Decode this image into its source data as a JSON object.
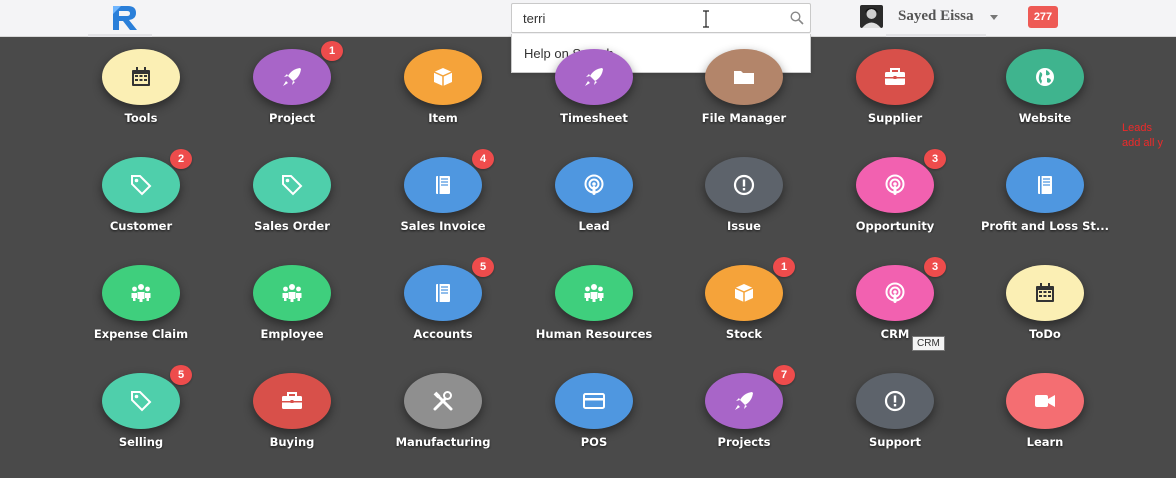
{
  "search": {
    "value": "terri",
    "dropdown_item": "Help on Search"
  },
  "user": {
    "name": "Sayed Eissa",
    "notifications": "277"
  },
  "tooltip": "CRM",
  "side_note": {
    "line1": "Leads",
    "line2": "add all y"
  },
  "tiles": [
    {
      "label": "Tools",
      "color": "#fbefb4",
      "icon": "calendar-icon",
      "badge": ""
    },
    {
      "label": "Project",
      "color": "#a865c8",
      "icon": "rocket-icon",
      "badge": "1"
    },
    {
      "label": "Item",
      "color": "#f5a33a",
      "icon": "box-icon",
      "badge": ""
    },
    {
      "label": "Timesheet",
      "color": "#a865c8",
      "icon": "rocket-icon",
      "badge": ""
    },
    {
      "label": "File Manager",
      "color": "#b3856a",
      "icon": "folder-icon",
      "badge": ""
    },
    {
      "label": "Supplier",
      "color": "#d8504a",
      "icon": "briefcase-icon",
      "badge": ""
    },
    {
      "label": "Website",
      "color": "#3fb48e",
      "icon": "globe-icon",
      "badge": ""
    },
    {
      "label": "Customer",
      "color": "#4fcfab",
      "icon": "tag-icon",
      "badge": "2"
    },
    {
      "label": "Sales Order",
      "color": "#4fcfab",
      "icon": "tag-icon",
      "badge": ""
    },
    {
      "label": "Sales Invoice",
      "color": "#4f97e0",
      "icon": "book-icon",
      "badge": "4"
    },
    {
      "label": "Lead",
      "color": "#4f97e0",
      "icon": "podcast-icon",
      "badge": ""
    },
    {
      "label": "Issue",
      "color": "#5d636b",
      "icon": "exclamation-icon",
      "badge": ""
    },
    {
      "label": "Opportunity",
      "color": "#f261b0",
      "icon": "podcast-icon",
      "badge": "3"
    },
    {
      "label": "Profit and Loss St...",
      "color": "#4f97e0",
      "icon": "book-icon",
      "badge": ""
    },
    {
      "label": "Expense Claim",
      "color": "#3fcf7d",
      "icon": "group-icon",
      "badge": ""
    },
    {
      "label": "Employee",
      "color": "#3fcf7d",
      "icon": "group-icon",
      "badge": ""
    },
    {
      "label": "Accounts",
      "color": "#4f97e0",
      "icon": "book-icon",
      "badge": "5"
    },
    {
      "label": "Human Resources",
      "color": "#3fcf7d",
      "icon": "group-icon",
      "badge": ""
    },
    {
      "label": "Stock",
      "color": "#f5a33a",
      "icon": "box-icon",
      "badge": "1"
    },
    {
      "label": "CRM",
      "color": "#f261b0",
      "icon": "podcast-icon",
      "badge": "3"
    },
    {
      "label": "ToDo",
      "color": "#fbefb4",
      "icon": "calendar-icon",
      "badge": ""
    },
    {
      "label": "Selling",
      "color": "#4fcfab",
      "icon": "tag-icon",
      "badge": "5"
    },
    {
      "label": "Buying",
      "color": "#d8504a",
      "icon": "briefcase-icon",
      "badge": ""
    },
    {
      "label": "Manufacturing",
      "color": "#8f8f8f",
      "icon": "tools-icon",
      "badge": ""
    },
    {
      "label": "POS",
      "color": "#4f97e0",
      "icon": "card-icon",
      "badge": ""
    },
    {
      "label": "Projects",
      "color": "#a865c8",
      "icon": "rocket-icon",
      "badge": "7"
    },
    {
      "label": "Support",
      "color": "#5d636b",
      "icon": "exclamation-icon",
      "badge": ""
    },
    {
      "label": "Learn",
      "color": "#f46e72",
      "icon": "video-icon",
      "badge": ""
    }
  ]
}
